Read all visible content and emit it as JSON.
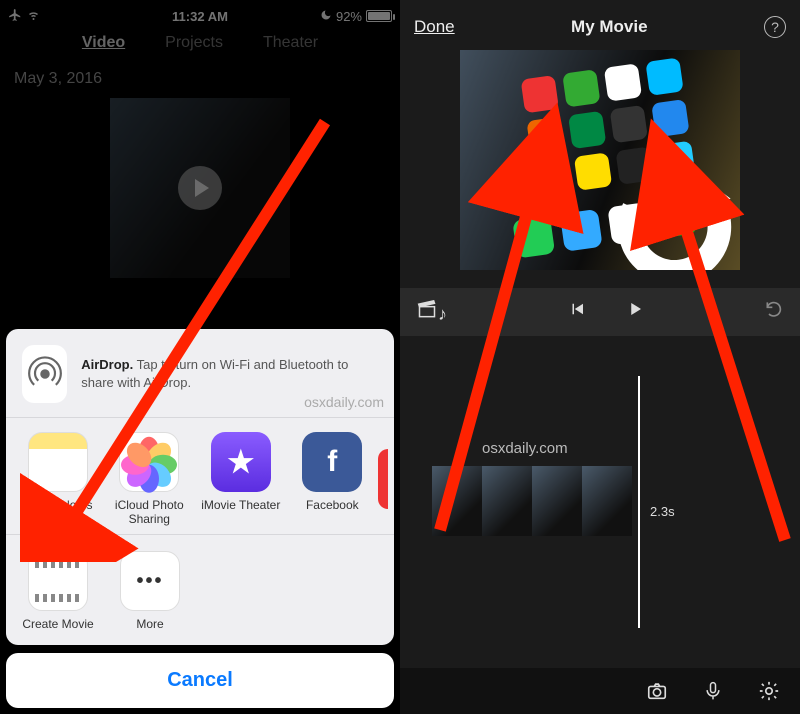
{
  "left": {
    "statusbar": {
      "time": "11:32 AM",
      "battery_pct": "92%"
    },
    "tabs": {
      "video": "Video",
      "projects": "Projects",
      "theater": "Theater"
    },
    "date": "May 3, 2016",
    "watermark": "osxdaily.com",
    "sheet": {
      "airdrop_bold": "AirDrop.",
      "airdrop_rest": " Tap to turn on Wi-Fi and Bluetooth to share with AirDrop.",
      "apps": {
        "notes": "Add to Notes",
        "photos": "iCloud Photo Sharing",
        "imovie": "iMovie Theater",
        "fb": "Facebook",
        "create": "Create Movie",
        "more": "More"
      },
      "cancel": "Cancel"
    }
  },
  "right": {
    "done": "Done",
    "title": "My Movie",
    "watermark": "osxdaily.com",
    "duration": "2.3s"
  }
}
